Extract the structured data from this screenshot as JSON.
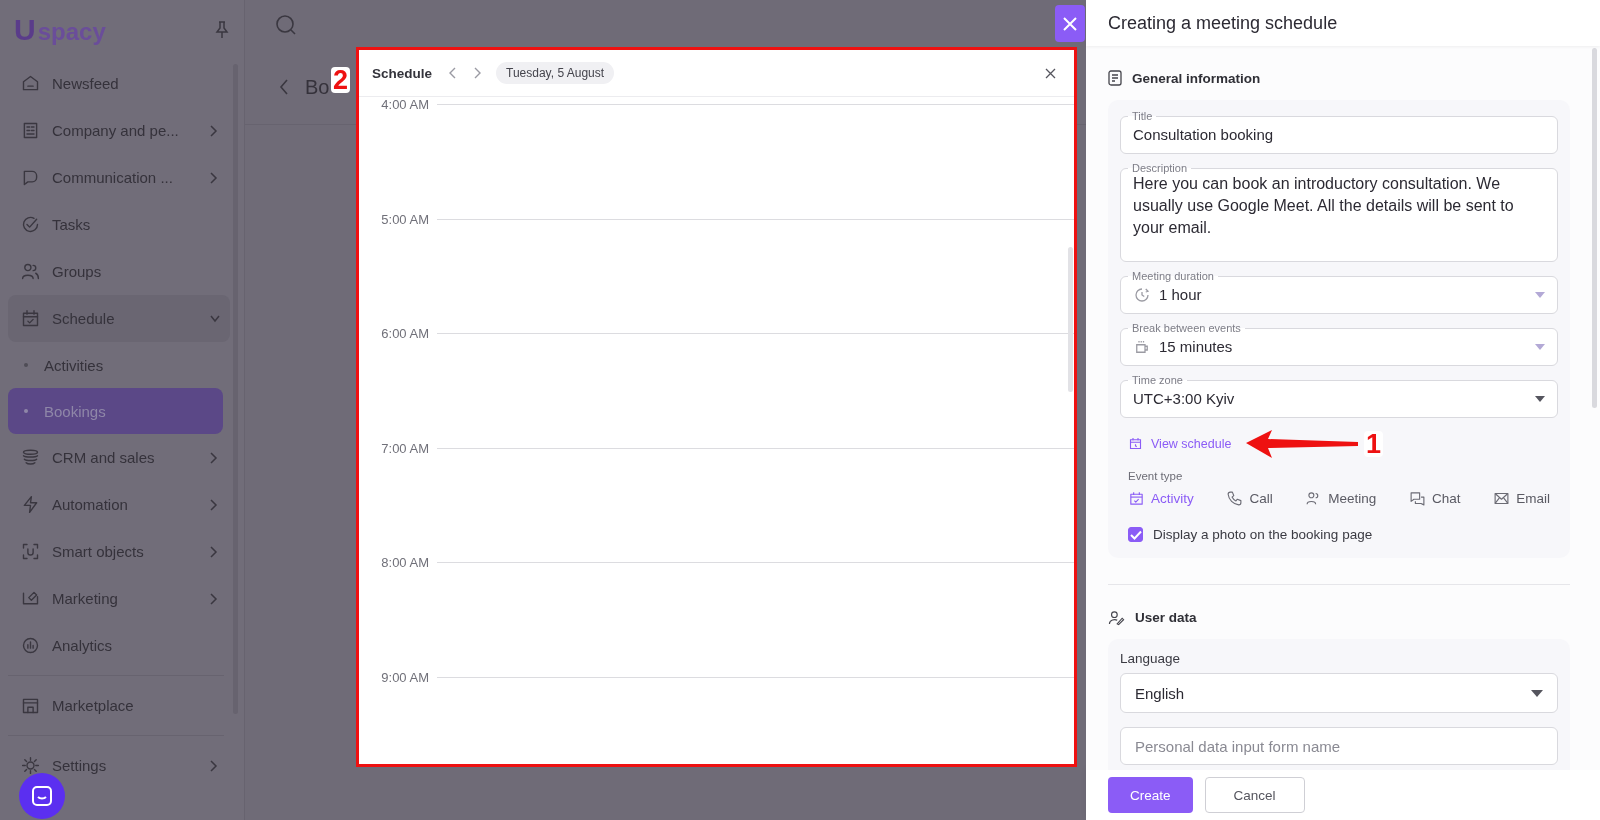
{
  "sidebar": {
    "logo": {
      "mark": "U",
      "text": "spacy"
    },
    "sections": [
      [
        {
          "label": "Newsfeed",
          "submenu": false
        },
        {
          "label": "Company and pe...",
          "submenu": true,
          "expanded": false
        },
        {
          "label": "Communication ...",
          "submenu": true,
          "expanded": false
        },
        {
          "label": "Tasks",
          "submenu": false
        },
        {
          "label": "Groups",
          "submenu": false
        },
        {
          "label": "Schedule",
          "submenu": true,
          "expanded": true,
          "children": [
            {
              "label": "Activities",
              "selected": false
            },
            {
              "label": "Bookings",
              "selected": true
            }
          ]
        },
        {
          "label": "CRM and sales",
          "submenu": true,
          "expanded": false
        },
        {
          "label": "Automation",
          "submenu": true,
          "expanded": false
        },
        {
          "label": "Smart objects",
          "submenu": true,
          "expanded": false
        },
        {
          "label": "Marketing",
          "submenu": true,
          "expanded": false
        },
        {
          "label": "Analytics",
          "submenu": false
        }
      ],
      [
        {
          "label": "Marketplace",
          "submenu": false
        }
      ],
      [
        {
          "label": "Settings",
          "submenu": true,
          "expanded": false
        }
      ]
    ]
  },
  "main": {
    "breadcrumb": "Bo"
  },
  "schedule_modal": {
    "title": "Schedule",
    "date": "Tuesday, 5 August",
    "times": [
      "4:00 AM",
      "5:00 AM",
      "6:00 AM",
      "7:00 AM",
      "8:00 AM",
      "9:00 AM"
    ]
  },
  "panel": {
    "title": "Creating a meeting schedule",
    "general": {
      "heading": "General information",
      "fields": [
        {
          "kind": "text",
          "label": "Title",
          "value": "Consultation booking"
        },
        {
          "kind": "textarea",
          "label": "Description",
          "value": "Here you can book an introductory consultation. We usually use Google Meet. All the details will be sent to your email."
        },
        {
          "kind": "select",
          "label": "Meeting duration",
          "value": "1 hour"
        },
        {
          "kind": "select",
          "label": "Break between events",
          "value": "15 minutes"
        },
        {
          "kind": "select",
          "label": "Time zone",
          "value": "UTC+3:00 Kyiv"
        }
      ],
      "link": "View schedule",
      "event_type_label": "Event type",
      "event_types": [
        {
          "label": "Activity",
          "selected": true
        },
        {
          "label": "Call",
          "selected": false
        },
        {
          "label": "Meeting",
          "selected": false
        },
        {
          "label": "Chat",
          "selected": false
        },
        {
          "label": "Email",
          "selected": false
        }
      ],
      "photo_checkbox": {
        "label": "Display a photo on the booking page",
        "checked": true
      }
    },
    "user_data": {
      "heading": "User data",
      "language_label": "Language",
      "language": "English",
      "form_name_placeholder": "Personal data input form name"
    },
    "buttons": [
      {
        "label": "Create",
        "kind": "primary"
      },
      {
        "label": "Cancel",
        "kind": "secondary"
      }
    ]
  },
  "annotations": [
    {
      "label": "2"
    },
    {
      "label": "1"
    }
  ]
}
